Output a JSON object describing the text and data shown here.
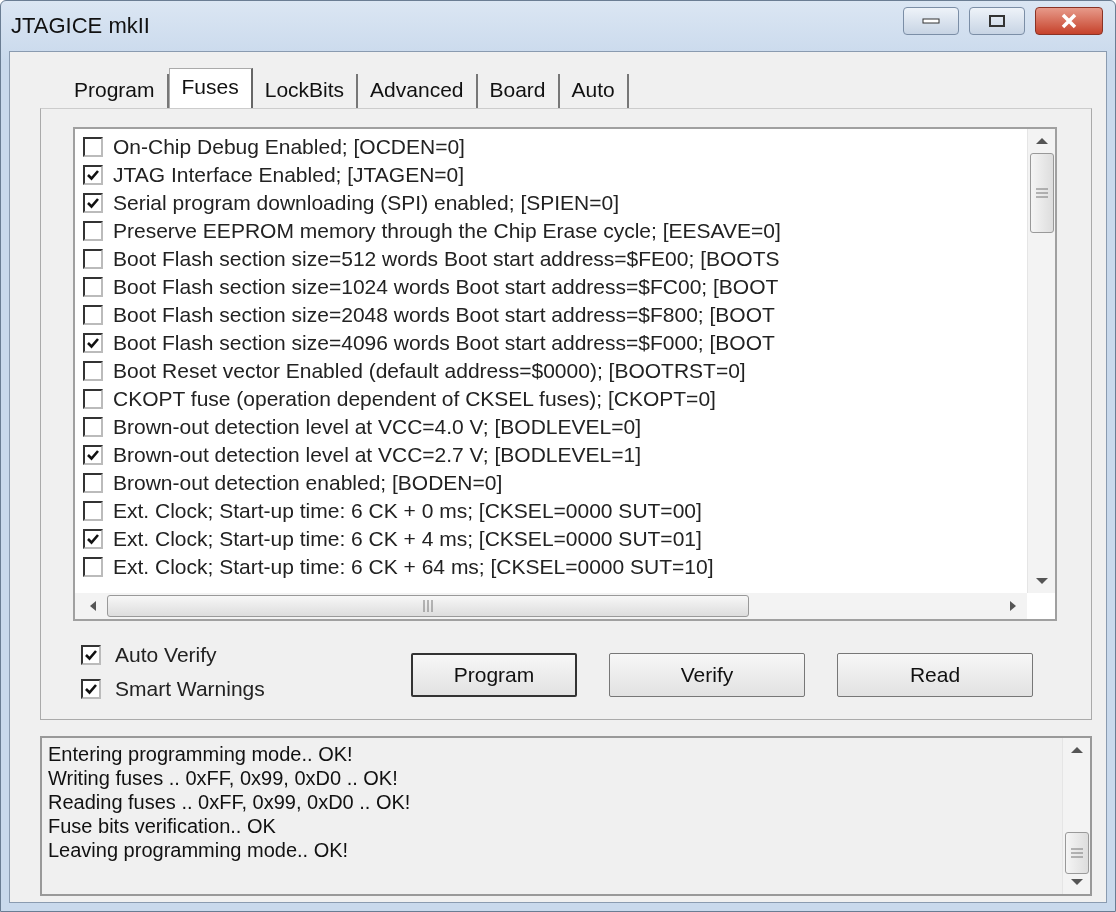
{
  "window": {
    "title": "JTAGICE mkII"
  },
  "tabs": [
    {
      "label": "Program",
      "selected": false
    },
    {
      "label": "Fuses",
      "selected": true
    },
    {
      "label": "LockBits",
      "selected": false
    },
    {
      "label": "Advanced",
      "selected": false
    },
    {
      "label": "Board",
      "selected": false
    },
    {
      "label": "Auto",
      "selected": false
    }
  ],
  "fuses": [
    {
      "label": "On-Chip Debug Enabled; [OCDEN=0]",
      "checked": false
    },
    {
      "label": "JTAG Interface Enabled; [JTAGEN=0]",
      "checked": true
    },
    {
      "label": "Serial program downloading (SPI) enabled; [SPIEN=0]",
      "checked": true
    },
    {
      "label": "Preserve EEPROM memory through the Chip Erase cycle; [EESAVE=0]",
      "checked": false
    },
    {
      "label": "Boot Flash section size=512 words Boot start address=$FE00; [BOOTS",
      "checked": false
    },
    {
      "label": "Boot Flash section size=1024 words Boot start address=$FC00; [BOOT",
      "checked": false
    },
    {
      "label": "Boot Flash section size=2048 words Boot start address=$F800; [BOOT",
      "checked": false
    },
    {
      "label": "Boot Flash section size=4096 words Boot start address=$F000; [BOOT",
      "checked": true
    },
    {
      "label": "Boot Reset vector Enabled (default address=$0000); [BOOTRST=0]",
      "checked": false
    },
    {
      "label": "CKOPT fuse (operation dependent of CKSEL fuses); [CKOPT=0]",
      "checked": false
    },
    {
      "label": "Brown-out detection level at VCC=4.0 V; [BODLEVEL=0]",
      "checked": false
    },
    {
      "label": "Brown-out detection level at VCC=2.7 V; [BODLEVEL=1]",
      "checked": true
    },
    {
      "label": "Brown-out detection enabled; [BODEN=0]",
      "checked": false
    },
    {
      "label": "Ext. Clock; Start-up time: 6 CK + 0 ms; [CKSEL=0000 SUT=00]",
      "checked": false
    },
    {
      "label": "Ext. Clock; Start-up time: 6 CK + 4 ms; [CKSEL=0000 SUT=01]",
      "checked": true
    },
    {
      "label": "Ext. Clock; Start-up time: 6 CK + 64 ms; [CKSEL=0000 SUT=10]",
      "checked": false
    }
  ],
  "options": [
    {
      "label": "Auto Verify",
      "checked": true
    },
    {
      "label": "Smart Warnings",
      "checked": true
    }
  ],
  "buttons": [
    {
      "label": "Program",
      "default": true
    },
    {
      "label": "Verify",
      "default": false
    },
    {
      "label": "Read",
      "default": false
    }
  ],
  "log": [
    "Entering programming mode.. OK!",
    "Writing fuses .. 0xFF, 0x99, 0xD0 .. OK!",
    "Reading fuses .. 0xFF, 0x99, 0xD0 .. OK!",
    "Fuse bits verification.. OK",
    "Leaving programming mode.. OK!"
  ]
}
